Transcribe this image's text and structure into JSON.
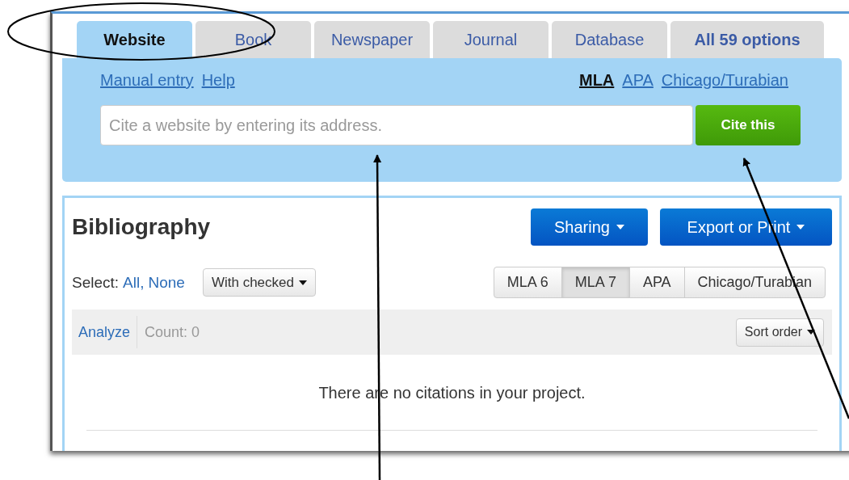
{
  "tabs": [
    {
      "label": "Website",
      "selected": true
    },
    {
      "label": "Book",
      "selected": false
    },
    {
      "label": "Newspaper",
      "selected": false
    },
    {
      "label": "Journal",
      "selected": false
    },
    {
      "label": "Database",
      "selected": false
    },
    {
      "label": "All 59 options",
      "selected": false,
      "bold": true
    }
  ],
  "cite_panel": {
    "links": [
      "Manual entry",
      "Help"
    ],
    "styles": [
      {
        "label": "MLA",
        "selected": true
      },
      {
        "label": "APA",
        "selected": false
      },
      {
        "label": "Chicago/Turabian",
        "selected": false
      }
    ],
    "placeholder": "Cite a website by entering its address.",
    "button": "Cite this"
  },
  "bibliography": {
    "title": "Bibliography",
    "buttons": [
      "Sharing",
      "Export or Print"
    ],
    "select_label": "Select:",
    "select_links": [
      "All,",
      "None"
    ],
    "with_checked": "With checked",
    "style_buttons": [
      {
        "label": "MLA 6",
        "selected": false
      },
      {
        "label": "MLA 7",
        "selected": true
      },
      {
        "label": "APA",
        "selected": false
      },
      {
        "label": "Chicago/Turabian",
        "selected": false
      }
    ],
    "analyze": "Analyze",
    "count": "Count: 0",
    "sort": "Sort order",
    "empty_message": "There are no citations in your project."
  }
}
